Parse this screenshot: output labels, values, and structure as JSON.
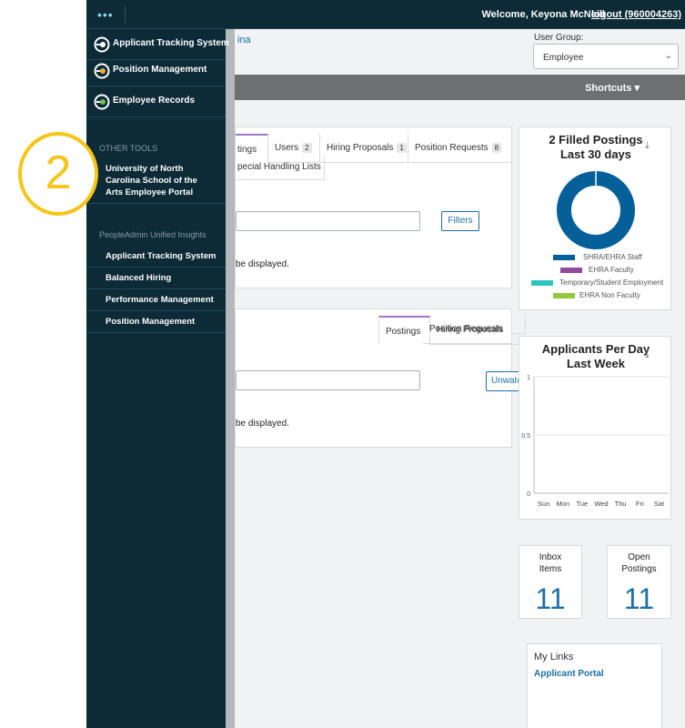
{
  "topbar": {
    "menu_glyph": "•••",
    "welcome": "Welcome, Keyona McNeill",
    "logout": "logout (960004263)"
  },
  "header": {
    "institution_fragment": "ina",
    "user_group_label": "User Group:",
    "user_group_value": "Employee",
    "shortcuts": "Shortcuts"
  },
  "panel1": {
    "tabs": [
      {
        "label": "tings",
        "badge": ""
      },
      {
        "label": "Users",
        "badge": "2"
      },
      {
        "label": "Hiring Proposals",
        "badge": "1"
      },
      {
        "label": "Position Requests",
        "badge": "8"
      }
    ],
    "second_row_tab": "pecial Handling Lists",
    "filters_button": "Filters",
    "empty_text": "be displayed."
  },
  "panel2": {
    "tabs": [
      {
        "label": "Postings"
      },
      {
        "label": "Hiring Proposals"
      },
      {
        "label": "Position Requests"
      }
    ],
    "unwatch_button": "Unwatch Postings",
    "empty_text": "be displayed."
  },
  "filled_card": {
    "title_line1": "2 Filled Postings",
    "title_line2": "Last 30 days",
    "legend": [
      {
        "label": "SHRA/EHRA Staff",
        "color": "#05609a"
      },
      {
        "label": "EHRA Faculty",
        "color": "#8e4a9e"
      },
      {
        "label": "Temporary/Student Employment",
        "color": "#2ec5c0"
      },
      {
        "label": "EHRA Non Faculty",
        "color": "#92c83e"
      }
    ]
  },
  "apps_card": {
    "title_line1": "Applicants Per Day",
    "title_line2": "Last Week"
  },
  "chart_data": [
    {
      "type": "pie",
      "title": "2 Filled Postings Last 30 days",
      "categories": [
        "SHRA/EHRA Staff",
        "EHRA Faculty",
        "Temporary/Student Employment",
        "EHRA Non Faculty"
      ],
      "values": [
        2,
        0,
        0,
        0
      ],
      "colors": [
        "#05609a",
        "#8e4a9e",
        "#2ec5c0",
        "#92c83e"
      ],
      "legend": "bottom"
    },
    {
      "type": "line",
      "title": "Applicants Per Day Last Week",
      "categories": [
        "Sun",
        "Mon",
        "Tue",
        "Wed",
        "Thu",
        "Fri",
        "Sat"
      ],
      "values": [
        0,
        0,
        0,
        0,
        0,
        0,
        0
      ],
      "yticks": [
        "1",
        "0.5",
        "0"
      ],
      "ylim": [
        0,
        1
      ],
      "grid": true
    }
  ],
  "stats": {
    "inbox_label_1": "Inbox",
    "inbox_label_2": "Items",
    "inbox_value": "11",
    "open_label_1": "Open",
    "open_label_2": "Postings",
    "open_value": "11"
  },
  "links": {
    "title": "My Links",
    "item": "Applicant Portal"
  },
  "sidebar": {
    "apps": [
      {
        "label": "Applicant Tracking System",
        "icon_color": "#ffffff"
      },
      {
        "label": "Position Management",
        "icon_color": "#f2a93b"
      },
      {
        "label": "Employee Records",
        "icon_color": "#6cc04a"
      }
    ],
    "other_tools_heading": "OTHER TOOLS",
    "other_tools": [
      "University of North Carolina School of the Arts Employee Portal"
    ],
    "insights_heading": "PeopleAdmin Unified Insights",
    "insights": [
      "Applicant Tracking System",
      "Balanced Hiring",
      "Performance Management",
      "Position Management"
    ]
  },
  "annotation": {
    "number": "2",
    "color": "#f5c518"
  }
}
